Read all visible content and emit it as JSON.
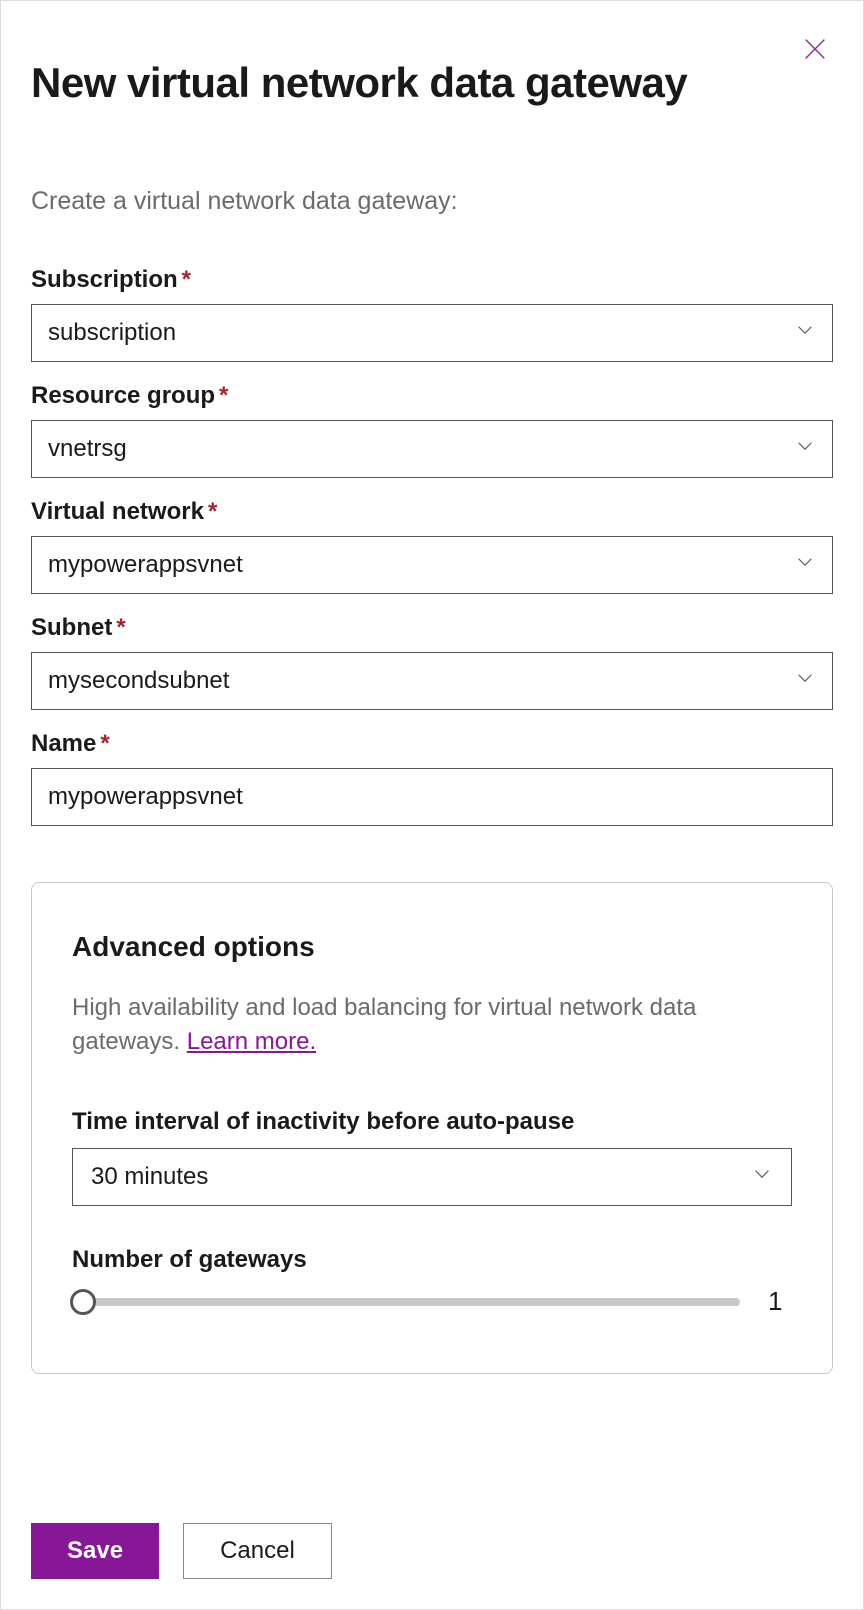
{
  "header": {
    "title": "New virtual network data gateway"
  },
  "subtitle": "Create a virtual network data gateway:",
  "fields": {
    "subscription": {
      "label": "Subscription",
      "value": "subscription",
      "required": true
    },
    "resource_group": {
      "label": "Resource group",
      "value": "vnetrsg",
      "required": true
    },
    "virtual_network": {
      "label": "Virtual network",
      "value": "mypowerappsvnet",
      "required": true
    },
    "subnet": {
      "label": "Subnet",
      "value": "mysecondsubnet",
      "required": true
    },
    "name": {
      "label": "Name",
      "value": "mypowerappsvnet",
      "required": true
    }
  },
  "advanced": {
    "title": "Advanced options",
    "description": "High availability and load balancing for virtual network data gateways. ",
    "learn_more": "Learn more.",
    "inactivity": {
      "label": "Time interval of inactivity before auto-pause",
      "value": "30 minutes"
    },
    "gateways": {
      "label": "Number of gateways",
      "value": "1"
    }
  },
  "footer": {
    "save": "Save",
    "cancel": "Cancel"
  }
}
